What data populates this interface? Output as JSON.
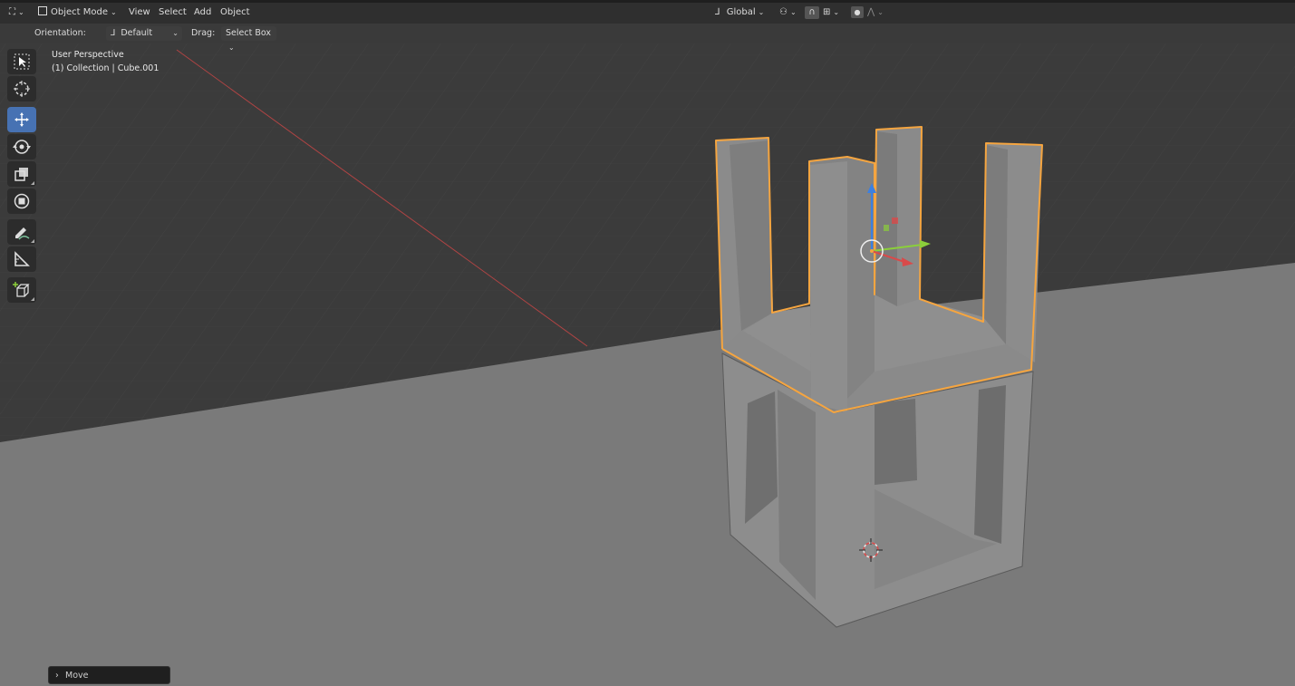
{
  "header": {
    "mode_label": "Object Mode",
    "menus": [
      "View",
      "Select",
      "Add",
      "Object"
    ],
    "transform_orientation": "Global"
  },
  "tool_settings": {
    "orientation_label": "Orientation:",
    "orientation_value": "Default",
    "drag_label": "Drag:",
    "drag_value": "Select Box"
  },
  "viewport": {
    "view_name": "User Perspective",
    "object_info": "(1) Collection | Cube.001"
  },
  "toolbar": {
    "tools": [
      "select-box-tool",
      "cursor-tool",
      "move-tool",
      "rotate-tool",
      "scale-tool",
      "transform-tool",
      "annotate-tool",
      "measure-tool",
      "add-cube-tool"
    ],
    "active_tool": "move-tool"
  },
  "last_operator": {
    "label": "Move"
  },
  "colors": {
    "selection_outline": "#f5a540",
    "active_tool": "#4772b3",
    "x_axis": "#d94a4a",
    "y_axis": "#8bcf3a",
    "z_axis": "#3d80e0"
  }
}
